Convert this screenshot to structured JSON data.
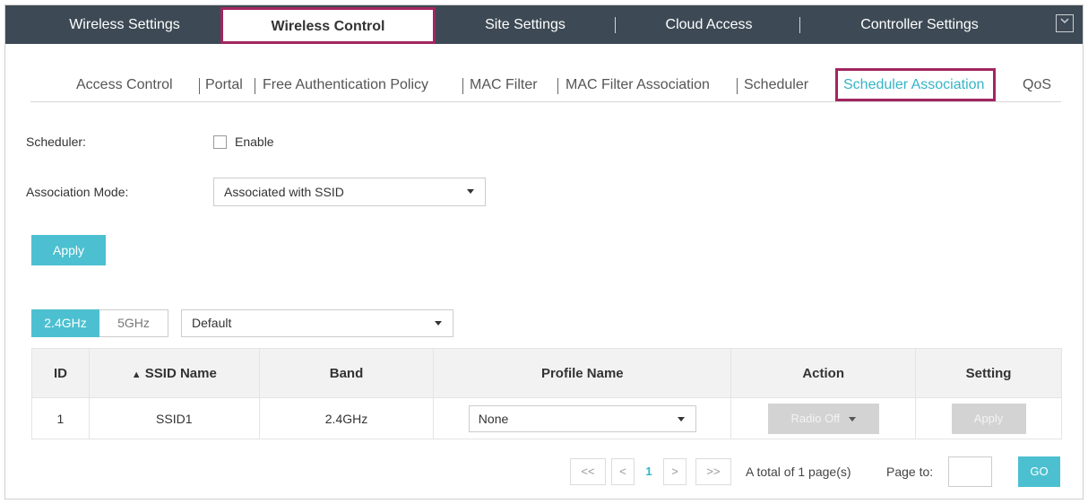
{
  "topnav": {
    "tabs": [
      "Wireless Settings",
      "Wireless Control",
      "Site Settings",
      "Cloud Access",
      "Controller Settings"
    ],
    "collapse_icon": "chevron-down-icon"
  },
  "subnav": {
    "items": [
      "Access Control",
      "Portal",
      "Free Authentication Policy",
      "MAC Filter",
      "MAC Filter Association",
      "Scheduler",
      "Scheduler Association",
      "QoS"
    ],
    "active": "Scheduler Association"
  },
  "form": {
    "scheduler_label": "Scheduler:",
    "enable_label": "Enable",
    "mode_label": "Association Mode:",
    "mode_value": "Associated with SSID",
    "apply_label": "Apply"
  },
  "band": {
    "tab_24": "2.4GHz",
    "tab_5": "5GHz",
    "group_value": "Default"
  },
  "table": {
    "headers": {
      "id": "ID",
      "ssid": "SSID Name",
      "sort_icon": "sort-icon",
      "band": "Band",
      "profile": "Profile Name",
      "action": "Action",
      "setting": "Setting"
    },
    "rows": [
      {
        "id": "1",
        "ssid": "SSID1",
        "band": "2.4GHz",
        "profile": "None",
        "action": "Radio Off",
        "setting": "Apply"
      }
    ]
  },
  "pagination": {
    "first": "<<",
    "prev": "<",
    "current": "1",
    "next": ">",
    "last": ">>",
    "total_text": "A total of 1 page(s)",
    "page_to": "Page to:",
    "go": "GO"
  },
  "colors": {
    "nav_bg": "#3d4a55",
    "accent": "#4cc0d0",
    "highlight": "#a12660"
  }
}
